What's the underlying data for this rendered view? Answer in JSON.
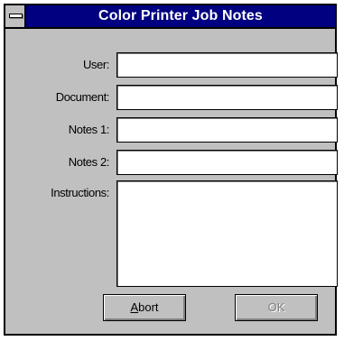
{
  "window": {
    "title": "Color Printer Job Notes"
  },
  "form": {
    "user_label": "User:",
    "document_label": "Document:",
    "notes1_label": "Notes 1:",
    "notes2_label": "Notes 2:",
    "instructions_label": "Instructions:",
    "user_value": "",
    "document_value": "",
    "notes1_value": "",
    "notes2_value": "",
    "instructions_value": ""
  },
  "buttons": {
    "abort_mnemonic": "A",
    "abort_rest": "bort",
    "ok_label": "OK",
    "ok_enabled": false
  },
  "icons": {
    "system_menu": "system-menu-icon"
  },
  "colors": {
    "titlebar": "#000080",
    "face": "#c0c0c0",
    "disabled_text": "#808080"
  }
}
